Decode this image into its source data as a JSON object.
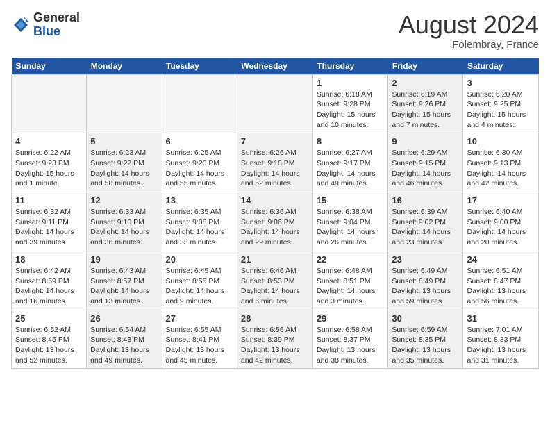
{
  "header": {
    "logo_general": "General",
    "logo_blue": "Blue",
    "month_year": "August 2024",
    "location": "Folembray, France"
  },
  "weekdays": [
    "Sunday",
    "Monday",
    "Tuesday",
    "Wednesday",
    "Thursday",
    "Friday",
    "Saturday"
  ],
  "weeks": [
    [
      {
        "day": "",
        "info": "",
        "shade": true
      },
      {
        "day": "",
        "info": "",
        "shade": true
      },
      {
        "day": "",
        "info": "",
        "shade": true
      },
      {
        "day": "",
        "info": "",
        "shade": true
      },
      {
        "day": "1",
        "info": "Sunrise: 6:18 AM\nSunset: 9:28 PM\nDaylight: 15 hours\nand 10 minutes."
      },
      {
        "day": "2",
        "info": "Sunrise: 6:19 AM\nSunset: 9:26 PM\nDaylight: 15 hours\nand 7 minutes.",
        "shade": true
      },
      {
        "day": "3",
        "info": "Sunrise: 6:20 AM\nSunset: 9:25 PM\nDaylight: 15 hours\nand 4 minutes."
      }
    ],
    [
      {
        "day": "4",
        "info": "Sunrise: 6:22 AM\nSunset: 9:23 PM\nDaylight: 15 hours\nand 1 minute."
      },
      {
        "day": "5",
        "info": "Sunrise: 6:23 AM\nSunset: 9:22 PM\nDaylight: 14 hours\nand 58 minutes.",
        "shade": true
      },
      {
        "day": "6",
        "info": "Sunrise: 6:25 AM\nSunset: 9:20 PM\nDaylight: 14 hours\nand 55 minutes."
      },
      {
        "day": "7",
        "info": "Sunrise: 6:26 AM\nSunset: 9:18 PM\nDaylight: 14 hours\nand 52 minutes.",
        "shade": true
      },
      {
        "day": "8",
        "info": "Sunrise: 6:27 AM\nSunset: 9:17 PM\nDaylight: 14 hours\nand 49 minutes."
      },
      {
        "day": "9",
        "info": "Sunrise: 6:29 AM\nSunset: 9:15 PM\nDaylight: 14 hours\nand 46 minutes.",
        "shade": true
      },
      {
        "day": "10",
        "info": "Sunrise: 6:30 AM\nSunset: 9:13 PM\nDaylight: 14 hours\nand 42 minutes."
      }
    ],
    [
      {
        "day": "11",
        "info": "Sunrise: 6:32 AM\nSunset: 9:11 PM\nDaylight: 14 hours\nand 39 minutes."
      },
      {
        "day": "12",
        "info": "Sunrise: 6:33 AM\nSunset: 9:10 PM\nDaylight: 14 hours\nand 36 minutes.",
        "shade": true
      },
      {
        "day": "13",
        "info": "Sunrise: 6:35 AM\nSunset: 9:08 PM\nDaylight: 14 hours\nand 33 minutes."
      },
      {
        "day": "14",
        "info": "Sunrise: 6:36 AM\nSunset: 9:06 PM\nDaylight: 14 hours\nand 29 minutes.",
        "shade": true
      },
      {
        "day": "15",
        "info": "Sunrise: 6:38 AM\nSunset: 9:04 PM\nDaylight: 14 hours\nand 26 minutes."
      },
      {
        "day": "16",
        "info": "Sunrise: 6:39 AM\nSunset: 9:02 PM\nDaylight: 14 hours\nand 23 minutes.",
        "shade": true
      },
      {
        "day": "17",
        "info": "Sunrise: 6:40 AM\nSunset: 9:00 PM\nDaylight: 14 hours\nand 20 minutes."
      }
    ],
    [
      {
        "day": "18",
        "info": "Sunrise: 6:42 AM\nSunset: 8:59 PM\nDaylight: 14 hours\nand 16 minutes."
      },
      {
        "day": "19",
        "info": "Sunrise: 6:43 AM\nSunset: 8:57 PM\nDaylight: 14 hours\nand 13 minutes.",
        "shade": true
      },
      {
        "day": "20",
        "info": "Sunrise: 6:45 AM\nSunset: 8:55 PM\nDaylight: 14 hours\nand 9 minutes."
      },
      {
        "day": "21",
        "info": "Sunrise: 6:46 AM\nSunset: 8:53 PM\nDaylight: 14 hours\nand 6 minutes.",
        "shade": true
      },
      {
        "day": "22",
        "info": "Sunrise: 6:48 AM\nSunset: 8:51 PM\nDaylight: 14 hours\nand 3 minutes."
      },
      {
        "day": "23",
        "info": "Sunrise: 6:49 AM\nSunset: 8:49 PM\nDaylight: 13 hours\nand 59 minutes.",
        "shade": true
      },
      {
        "day": "24",
        "info": "Sunrise: 6:51 AM\nSunset: 8:47 PM\nDaylight: 13 hours\nand 56 minutes."
      }
    ],
    [
      {
        "day": "25",
        "info": "Sunrise: 6:52 AM\nSunset: 8:45 PM\nDaylight: 13 hours\nand 52 minutes."
      },
      {
        "day": "26",
        "info": "Sunrise: 6:54 AM\nSunset: 8:43 PM\nDaylight: 13 hours\nand 49 minutes.",
        "shade": true
      },
      {
        "day": "27",
        "info": "Sunrise: 6:55 AM\nSunset: 8:41 PM\nDaylight: 13 hours\nand 45 minutes."
      },
      {
        "day": "28",
        "info": "Sunrise: 6:56 AM\nSunset: 8:39 PM\nDaylight: 13 hours\nand 42 minutes.",
        "shade": true
      },
      {
        "day": "29",
        "info": "Sunrise: 6:58 AM\nSunset: 8:37 PM\nDaylight: 13 hours\nand 38 minutes."
      },
      {
        "day": "30",
        "info": "Sunrise: 6:59 AM\nSunset: 8:35 PM\nDaylight: 13 hours\nand 35 minutes.",
        "shade": true
      },
      {
        "day": "31",
        "info": "Sunrise: 7:01 AM\nSunset: 8:33 PM\nDaylight: 13 hours\nand 31 minutes."
      }
    ]
  ]
}
